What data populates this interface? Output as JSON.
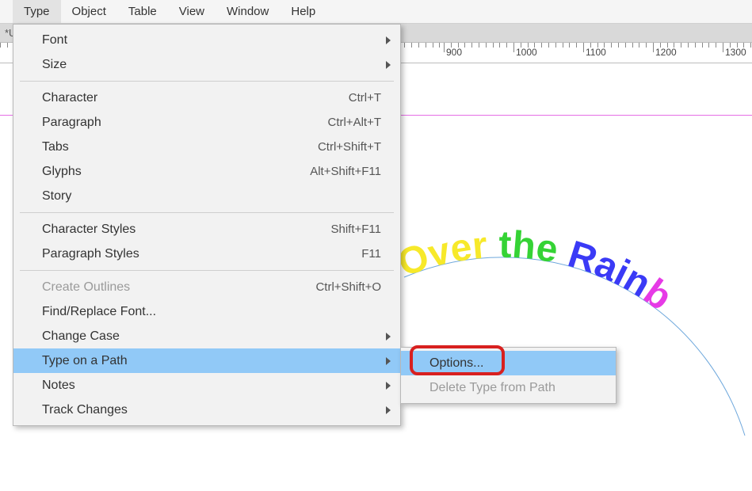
{
  "menubar": {
    "items": [
      {
        "label": "Type",
        "active": true
      },
      {
        "label": "Object"
      },
      {
        "label": "Table"
      },
      {
        "label": "View"
      },
      {
        "label": "Window"
      },
      {
        "label": "Help"
      }
    ]
  },
  "doc_bar": {
    "label": "*U"
  },
  "ruler": {
    "ticks": [
      900,
      1000,
      1100,
      1200,
      1300
    ]
  },
  "dropdown": {
    "groups": [
      [
        {
          "label": "Font",
          "arrow": true
        },
        {
          "label": "Size",
          "arrow": true
        }
      ],
      [
        {
          "label": "Character",
          "shortcut": "Ctrl+T"
        },
        {
          "label": "Paragraph",
          "shortcut": "Ctrl+Alt+T"
        },
        {
          "label": "Tabs",
          "shortcut": "Ctrl+Shift+T"
        },
        {
          "label": "Glyphs",
          "shortcut": "Alt+Shift+F11"
        },
        {
          "label": "Story"
        }
      ],
      [
        {
          "label": "Character Styles",
          "shortcut": "Shift+F11"
        },
        {
          "label": "Paragraph Styles",
          "shortcut": "F11"
        }
      ],
      [
        {
          "label": "Create Outlines",
          "shortcut": "Ctrl+Shift+O",
          "disabled": true
        },
        {
          "label": "Find/Replace Font..."
        },
        {
          "label": "Change Case",
          "arrow": true
        },
        {
          "label": "Type on a Path",
          "arrow": true,
          "hovered": true
        },
        {
          "label": "Notes",
          "arrow": true
        },
        {
          "label": "Track Changes",
          "arrow": true
        }
      ]
    ]
  },
  "submenu": {
    "items": [
      {
        "label": "Options...",
        "hovered": true,
        "highlighted": true
      },
      {
        "label": "Delete Type from Path",
        "disabled": true
      }
    ]
  },
  "curved_text": {
    "words": [
      {
        "text": "Over",
        "color": "#f7e92a"
      },
      {
        "text": "the",
        "color": "#35d335"
      },
      {
        "text": "Rainb",
        "color": "#3a3af6"
      }
    ]
  }
}
